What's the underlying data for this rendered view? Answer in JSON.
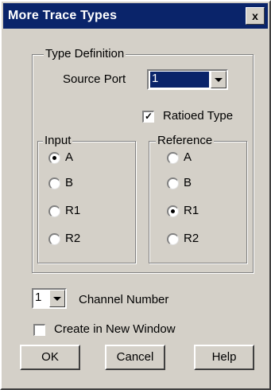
{
  "window": {
    "title": "More Trace Types",
    "close_glyph": "x"
  },
  "type_definition": {
    "legend": "Type Definition",
    "source_port_label": "Source Port",
    "source_port_value": "1",
    "ratioed_label": "Ratioed Type",
    "ratioed_checked": true
  },
  "input": {
    "legend": "Input",
    "options": [
      "A",
      "B",
      "R1",
      "R2"
    ],
    "selected": "A"
  },
  "reference": {
    "legend": "Reference",
    "options": [
      "A",
      "B",
      "R1",
      "R2"
    ],
    "selected": "R1"
  },
  "channel": {
    "value": "1",
    "label": "Channel Number"
  },
  "new_window": {
    "label": "Create in New Window",
    "checked": false
  },
  "buttons": {
    "ok": "OK",
    "cancel": "Cancel",
    "help": "Help"
  },
  "colors": {
    "titlebar": "#0a246a",
    "face": "#d4d0c8"
  }
}
